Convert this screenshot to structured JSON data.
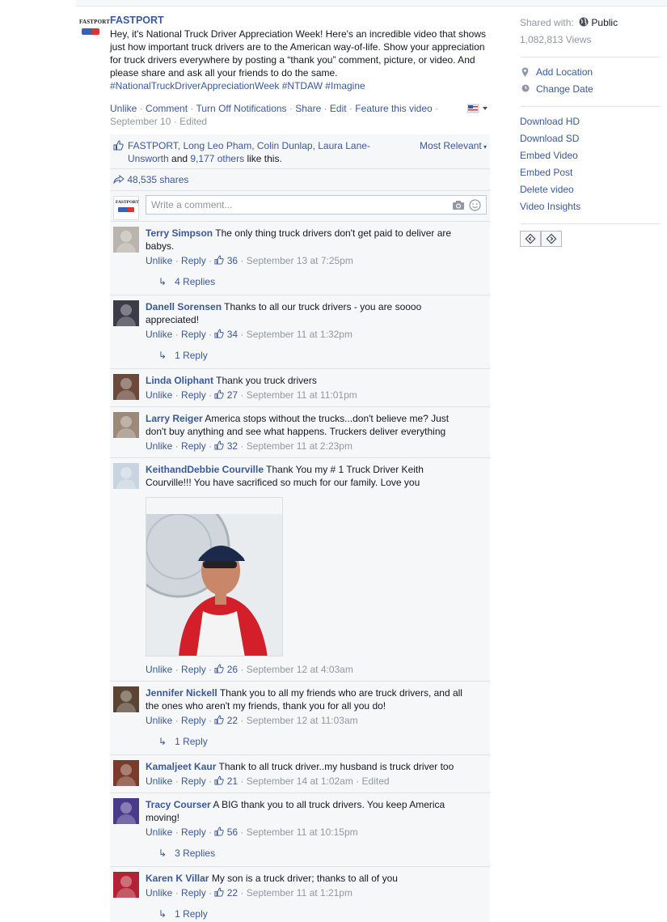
{
  "post": {
    "page_name": "FASTPORT",
    "avatar_text": "FASTPORT",
    "message_text": "Hey, it's National Truck Driver Appreciation Week! Here's an incredible video that shows just how important truck drivers are to the American way-of-life. Show your appreciation for truck drivers everywhere by posting a “thank you” comment, picture, or video. And please share and ask all your friends to do the same. ",
    "message_tags": "#NationalTruckDriverAppreciationWeek #NTDAW #Imagine",
    "actions": {
      "unlike": "Unlike",
      "comment": "Comment",
      "turn_off_notifications": "Turn Off Notifications",
      "share": "Share",
      "edit": "Edit",
      "feature": "Feature this video",
      "date": "September 10",
      "edited": "Edited"
    },
    "likes": {
      "names": "FASTPORT, Long Leo Pham, Colin Dunlap, Laura Lane-Unsworth",
      "and": " and ",
      "others": "9,177 others",
      "suffix": " like this."
    },
    "most_relevant": "Most Relevant",
    "shares": "48,535 shares",
    "comment_placeholder": "Write a comment..."
  },
  "comments": [
    {
      "name": "Terry Simpson",
      "text": "The only thing truck drivers don't get paid to deliver are babys.",
      "likes": "36",
      "time": "September 13 at 7:25pm",
      "edited": "",
      "replies": "4 Replies",
      "avatar_color": "#b9b4ad"
    },
    {
      "name": "Danell Sorensen",
      "text": "Thanks to all our truck drivers - you are soooo appreciated!",
      "likes": "34",
      "time": "September 11 at 1:32pm",
      "edited": "",
      "replies": "1 Reply",
      "avatar_color": "#3d3a4a"
    },
    {
      "name": "Linda Oliphant",
      "text": "Thank you truck drivers",
      "likes": "27",
      "time": "September 11 at 11:01pm",
      "edited": "",
      "replies": "",
      "avatar_color": "#6b4a3c"
    },
    {
      "name": "Larry Reiger",
      "text": "America stops without the trucks...don't believe me? Just don't buy anything and see what happens. Truckers deliver everything",
      "likes": "32",
      "time": "September 11 at 2:23pm",
      "edited": "",
      "replies": "",
      "avatar_color": "#9b8a7a"
    },
    {
      "name": "KeithandDebbie Courville",
      "text": "Thank You my # 1 Truck Driver Keith Courville!!! You have sacrificed so much for our family. Love you",
      "likes": "26",
      "time": "September 12 at 4:03am",
      "edited": "",
      "replies": "",
      "avatar_color": "#c8d4e0"
    },
    {
      "name": "Jennifer Nickell",
      "text": "Thank you to all my friends who are truck drivers, and all the ones who aren't my friends, thank you for all you do!",
      "likes": "22",
      "time": "September 12 at 11:03am",
      "edited": "",
      "replies": "1 Reply",
      "avatar_color": "#5a4535"
    },
    {
      "name": "Kamaljeet Kaur",
      "text": "Thank to all truck driver..my husband is truck driver too",
      "likes": "21",
      "time": "September 14 at 1:02am",
      "edited": "Edited",
      "replies": "",
      "avatar_color": "#7a3b2a"
    },
    {
      "name": "Tracy Courser",
      "text": "A BIG thank you to all truck drivers. You keep America moving!",
      "likes": "56",
      "time": "September 11 at 10:15pm",
      "edited": "",
      "replies": "3 Replies",
      "avatar_color": "#4a3a8a"
    },
    {
      "name": "Karen K Villar",
      "text": "My son is a truck driver; thanks to all of you",
      "likes": "22",
      "time": "September 11 at 1:21pm",
      "edited": "",
      "replies": "1 Reply",
      "avatar_color": "#b22234"
    }
  ],
  "comment_action_labels": {
    "unlike": "Unlike",
    "reply": "Reply"
  },
  "sidebar": {
    "shared_with_label": "Shared with:",
    "privacy": "Public",
    "views": "1,082,813 Views",
    "add_location": "Add Location",
    "change_date": "Change Date",
    "links": [
      "Download HD",
      "Download SD",
      "Embed Video",
      "Embed Post",
      "Delete video",
      "Video Insights"
    ]
  },
  "colors": {
    "link": "#3b5998",
    "meta": "#9197a3",
    "panel": "#f6f7f8"
  }
}
